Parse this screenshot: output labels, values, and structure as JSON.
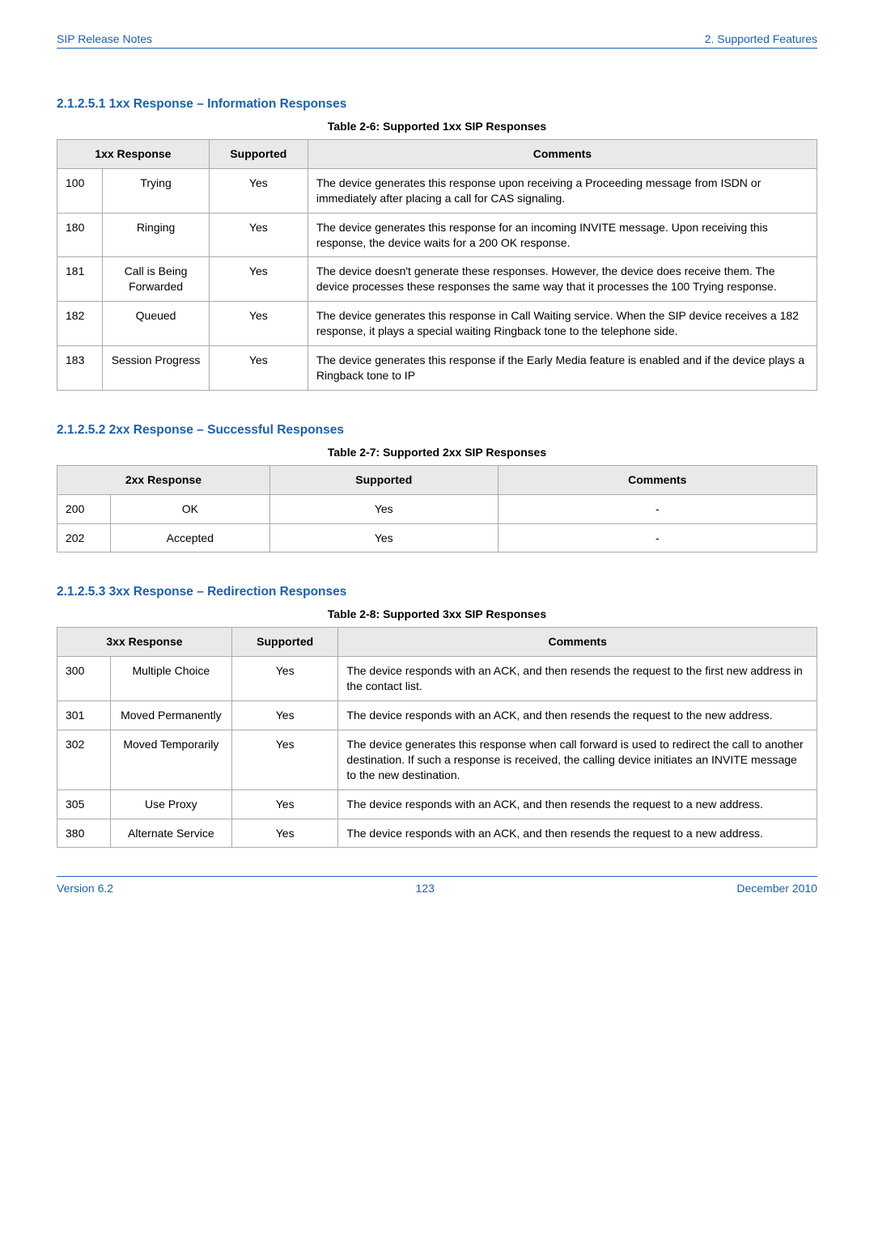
{
  "header": {
    "left": "SIP Release Notes",
    "right": "2. Supported Features"
  },
  "s1": {
    "heading": "2.1.2.5.1  1xx Response – Information Responses",
    "caption": "Table 2-6: Supported 1xx SIP Responses",
    "th": {
      "c1": "1xx Response",
      "c2": "Supported",
      "c3": "Comments"
    },
    "rows": [
      {
        "code": "100",
        "name": "Trying",
        "sup": "Yes",
        "cmt": "The device generates this response upon receiving a Proceeding message from ISDN or immediately after placing a call for CAS signaling."
      },
      {
        "code": "180",
        "name": "Ringing",
        "sup": "Yes",
        "cmt": "The device generates this response for an incoming INVITE message. Upon receiving this response, the device waits for a 200 OK response."
      },
      {
        "code": "181",
        "name": "Call is Being Forwarded",
        "sup": "Yes",
        "cmt": "The device doesn't generate these responses. However, the device does receive them. The device processes these responses the same way that it processes the 100 Trying response."
      },
      {
        "code": "182",
        "name": "Queued",
        "sup": "Yes",
        "cmt": "The device generates this response in Call Waiting service. When the SIP device receives a 182 response, it plays a special waiting Ringback tone to the telephone side."
      },
      {
        "code": "183",
        "name": "Session Progress",
        "sup": "Yes",
        "cmt": "The device generates this response if the Early Media feature is enabled and if the device plays a Ringback tone to IP"
      }
    ]
  },
  "s2": {
    "heading": "2.1.2.5.2  2xx Response – Successful Responses",
    "caption": "Table 2-7: Supported 2xx SIP Responses",
    "th": {
      "c1": "2xx Response",
      "c2": "Supported",
      "c3": "Comments"
    },
    "rows": [
      {
        "code": "200",
        "name": "OK",
        "sup": "Yes",
        "cmt": "-"
      },
      {
        "code": "202",
        "name": "Accepted",
        "sup": "Yes",
        "cmt": "-"
      }
    ]
  },
  "s3": {
    "heading": "2.1.2.5.3  3xx Response – Redirection Responses",
    "caption": "Table 2-8: Supported 3xx SIP Responses",
    "th": {
      "c1": "3xx Response",
      "c2": "Supported",
      "c3": "Comments"
    },
    "rows": [
      {
        "code": "300",
        "name": "Multiple Choice",
        "sup": "Yes",
        "cmt": "The device responds with an ACK, and then resends the request to the first new address in the contact list."
      },
      {
        "code": "301",
        "name": "Moved Permanently",
        "sup": "Yes",
        "cmt": "The device responds with an ACK, and then resends the request to the new address."
      },
      {
        "code": "302",
        "name": "Moved Temporarily",
        "sup": "Yes",
        "cmt": "The device generates this response when call forward is used to redirect the call to another destination. If such a response is received, the calling device initiates an INVITE message to the new destination."
      },
      {
        "code": "305",
        "name": "Use Proxy",
        "sup": "Yes",
        "cmt": "The device responds with an ACK, and then resends the request to a new address."
      },
      {
        "code": "380",
        "name": "Alternate Service",
        "sup": "Yes",
        "cmt": "The device responds with an ACK, and then resends the request to a new address."
      }
    ]
  },
  "footer": {
    "left": "Version 6.2",
    "mid": "123",
    "right": "December 2010"
  }
}
